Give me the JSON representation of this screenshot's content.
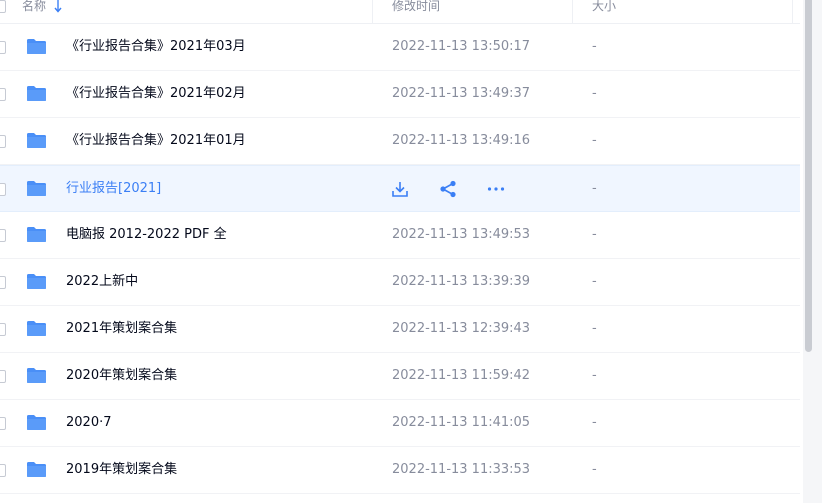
{
  "header": {
    "name_label": "名称",
    "time_label": "修改时间",
    "size_label": "大小",
    "sort_icon": "arrow-down-icon"
  },
  "colors": {
    "accent": "#3b7ff5",
    "folder": "#4a8ff7",
    "hover_row": "#f0f6ff",
    "secondary_text": "#878c9c"
  },
  "files": [
    {
      "name": "《行业报告合集》2021年03月",
      "time": "2022-11-13 13:50:17",
      "size": "-"
    },
    {
      "name": "《行业报告合集》2021年02月",
      "time": "2022-11-13 13:49:37",
      "size": "-"
    },
    {
      "name": "《行业报告合集》2021年01月",
      "time": "2022-11-13 13:49:16",
      "size": "-"
    },
    {
      "name": "行业报告[2021]",
      "time": "",
      "size": "-",
      "hovered": true,
      "actions": [
        "download-icon",
        "share-icon",
        "more-icon"
      ]
    },
    {
      "name": "电脑报 2012-2022 PDF 全",
      "time": "2022-11-13 13:49:53",
      "size": "-"
    },
    {
      "name": "2022上新中",
      "time": "2022-11-13 13:39:39",
      "size": "-"
    },
    {
      "name": "2021年策划案合集",
      "time": "2022-11-13 12:39:43",
      "size": "-"
    },
    {
      "name": "2020年策划案合集",
      "time": "2022-11-13 11:59:42",
      "size": "-"
    },
    {
      "name": "2020·7",
      "time": "2022-11-13 11:41:05",
      "size": "-"
    },
    {
      "name": "2019年策划案合集",
      "time": "2022-11-13 11:33:53",
      "size": "-"
    }
  ]
}
